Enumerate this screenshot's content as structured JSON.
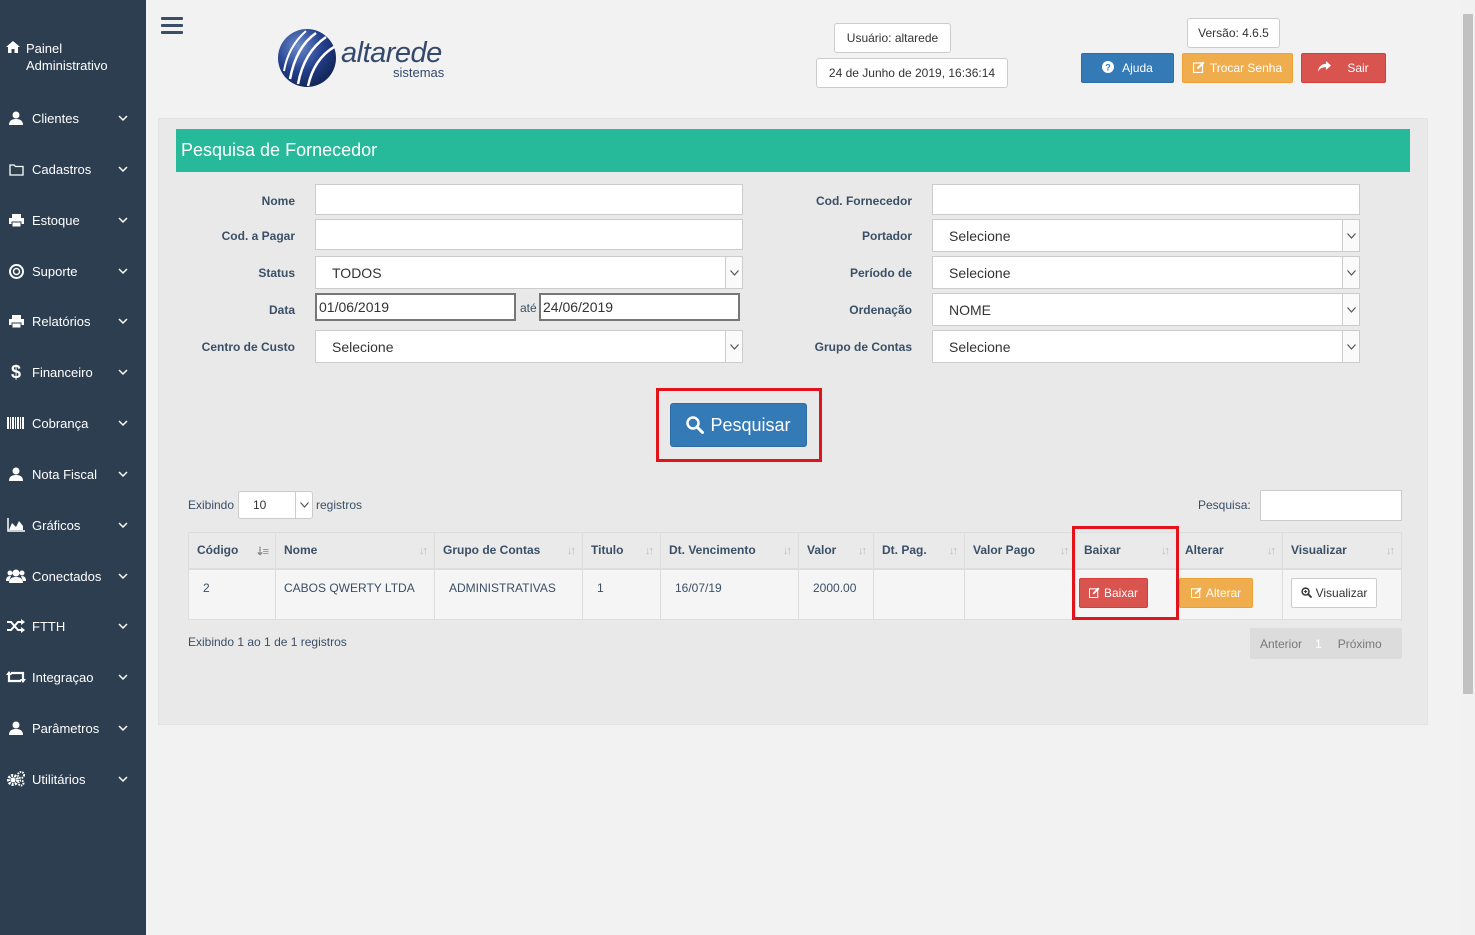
{
  "sidebar": {
    "home": "Painel Administrativo",
    "items": [
      {
        "label": "Clientes",
        "icon": "user-icon"
      },
      {
        "label": "Cadastros",
        "icon": "folder-icon"
      },
      {
        "label": "Estoque",
        "icon": "printer-icon"
      },
      {
        "label": "Suporte",
        "icon": "lifebuoy-icon"
      },
      {
        "label": "Relatórios",
        "icon": "printer-icon"
      },
      {
        "label": "Financeiro",
        "icon": "dollar-icon"
      },
      {
        "label": "Cobrança",
        "icon": "barcode-icon"
      },
      {
        "label": "Nota Fiscal",
        "icon": "user-icon"
      },
      {
        "label": "Gráficos",
        "icon": "area-chart-icon"
      },
      {
        "label": "Conectados",
        "icon": "users-icon"
      },
      {
        "label": "FTTH",
        "icon": "shuffle-icon"
      },
      {
        "label": "Integraçao",
        "icon": "retweet-icon"
      },
      {
        "label": "Parâmetros",
        "icon": "user-icon"
      },
      {
        "label": "Utilitários",
        "icon": "cogs-icon"
      }
    ]
  },
  "header": {
    "logo_main": "altarede",
    "logo_sub": "sistemas",
    "user": "Usuário: altarede",
    "datetime": "24 de Junho de 2019, 16:36:14",
    "version": "Versão: 4.6.5",
    "help": "Ajuda",
    "change_password": "Trocar Senha",
    "logout": "Sair"
  },
  "form": {
    "title": "Pesquisa de Fornecedor",
    "nome_label": "Nome",
    "nome_value": "",
    "cod_pagar_label": "Cod. a Pagar",
    "cod_pagar_value": "",
    "status_label": "Status",
    "status_value": "TODOS",
    "data_label": "Data",
    "data_from": "01/06/2019",
    "ate": "até",
    "data_to": "24/06/2019",
    "centro_label": "Centro de Custo",
    "centro_value": "Selecione",
    "cod_fornecedor_label": "Cod. Fornecedor",
    "cod_fornecedor_value": "",
    "portador_label": "Portador",
    "portador_value": "Selecione",
    "periodo_label": "Período de",
    "periodo_value": "Selecione",
    "ordenacao_label": "Ordenação",
    "ordenacao_value": "NOME",
    "grupo_label": "Grupo de Contas",
    "grupo_value": "Selecione",
    "search_button": "Pesquisar"
  },
  "table": {
    "exibindo": "Exibindo",
    "length_value": "10",
    "registros": "registros",
    "search_label": "Pesquisa:",
    "columns": [
      "Código",
      "Nome",
      "Grupo de Contas",
      "Titulo",
      "Dt. Vencimento",
      "Valor",
      "Dt. Pag.",
      "Valor Pago",
      "Baixar",
      "Alterar",
      "Visualizar"
    ],
    "rows": [
      {
        "codigo": "2",
        "nome": "CABOS QWERTY LTDA",
        "grupo": "ADMINISTRATIVAS",
        "titulo": "1",
        "vencimento": "16/07/19",
        "valor": "2000.00",
        "dt_pag": "",
        "valor_pago": "",
        "baixar": "Baixar",
        "alterar": "Alterar",
        "visualizar": "Visualizar"
      }
    ],
    "info": "Exibindo 1 ao 1 de 1 registros",
    "prev": "Anterior",
    "page": "1",
    "next": "Próximo"
  },
  "colors": {
    "sidebar": "#2c3e50",
    "title_bar": "#26b99a",
    "primary": "#337ab7",
    "danger": "#d9534f",
    "warning": "#f0ad4e",
    "highlight": "#e2141b"
  }
}
